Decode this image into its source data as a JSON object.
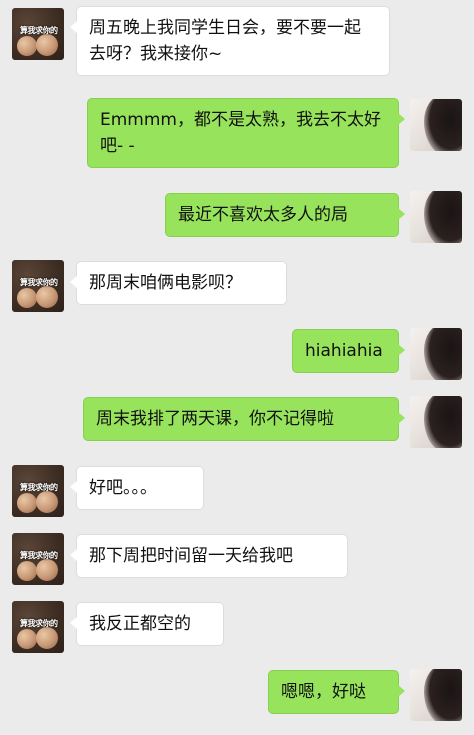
{
  "messages": [
    {
      "side": "left",
      "text": "周五晚上我同学生日会，要不要一起去呀？我来接你~"
    },
    {
      "side": "right",
      "text": "Emmmm，都不是太熟，我去不太好吧- -"
    },
    {
      "side": "right",
      "text": "最近不喜欢太多人的局"
    },
    {
      "side": "left",
      "text": "那周末咱俩电影呗？"
    },
    {
      "side": "right",
      "text": "hiahiahia"
    },
    {
      "side": "right",
      "text": "周末我排了两天课，你不记得啦"
    },
    {
      "side": "left",
      "text": "好吧。。。"
    },
    {
      "side": "left",
      "text": "那下周把时间留一天给我吧"
    },
    {
      "side": "left",
      "text": "我反正都空的"
    },
    {
      "side": "right",
      "text": "嗯嗯，好哒"
    }
  ],
  "avatars": {
    "friend": {
      "icon": "friend-avatar-icon",
      "caption": "算我求你的"
    },
    "me": {
      "icon": "user-avatar-icon"
    }
  },
  "colors": {
    "background": "#ebebeb",
    "bubble_left": "#ffffff",
    "bubble_right": "#97e35c"
  }
}
